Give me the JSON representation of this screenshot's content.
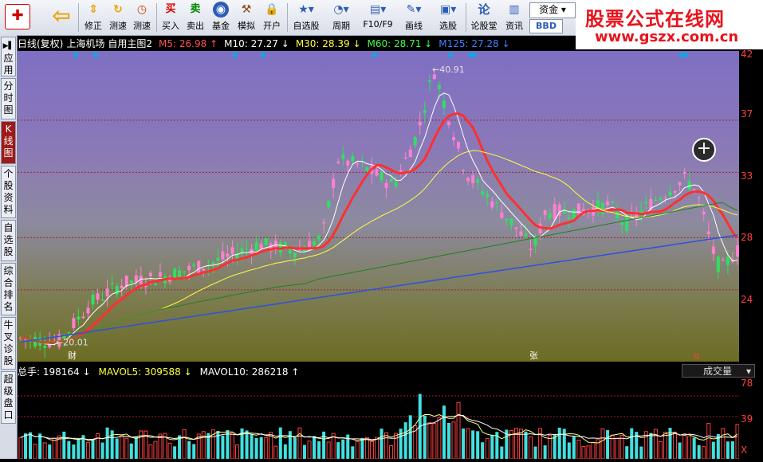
{
  "toolbar": {
    "items": [
      {
        "label": "",
        "icon": "app-logo-icon"
      },
      {
        "label": "",
        "icon": "back-arrow-icon"
      },
      {
        "label": "修正",
        "icon": "up-down-arrows-icon"
      },
      {
        "label": "测速",
        "icon": "timer-icon"
      },
      {
        "label": "买入",
        "icon": "buy-icon",
        "glyph": "买"
      },
      {
        "label": "卖出",
        "icon": "sell-icon",
        "glyph": "卖"
      },
      {
        "label": "基金",
        "icon": "fund-icon"
      },
      {
        "label": "模拟",
        "icon": "hammer-icon"
      },
      {
        "label": "开户",
        "icon": "lock-icon"
      },
      {
        "label": "自选股",
        "icon": "star-folder-icon"
      },
      {
        "label": "周期",
        "icon": "clock-icon"
      },
      {
        "label": "F10/F9",
        "icon": "f10-icon"
      },
      {
        "label": "画线",
        "icon": "pencil-icon"
      },
      {
        "label": "选股",
        "icon": "monitor-icon"
      },
      {
        "label": "论股堂",
        "icon": "forum-icon",
        "glyph": "论"
      },
      {
        "label": "资讯",
        "icon": "news-icon"
      }
    ],
    "fund_button": "资金",
    "bbd_button": "BBD"
  },
  "watermark": {
    "title": "股票公式在线网",
    "url": "www.gszx.com.cn"
  },
  "side_tabs": [
    "应用",
    "分时图",
    "K线图",
    "个股资料",
    "自选股",
    "综合排名",
    "牛叉诊股",
    "超级盘口"
  ],
  "info": {
    "mode": "日线(复权)",
    "stock": "上海机场",
    "formula": "自用主图2",
    "ma": [
      {
        "text": "M5: 26.98",
        "color": "#ff5050",
        "arrow": "up"
      },
      {
        "text": "M10: 27.27",
        "color": "#ffffff",
        "arrow": "down"
      },
      {
        "text": "M30: 28.39",
        "color": "#ffff40",
        "arrow": "down"
      },
      {
        "text": "M60: 28.71",
        "color": "#40ff40",
        "arrow": "down"
      },
      {
        "text": "M125: 27.28",
        "color": "#4080ff",
        "arrow": "down"
      }
    ]
  },
  "annotations": {
    "high": "40.91",
    "low": "20.01",
    "marker1": "财",
    "marker2": "张",
    "marker3": "q"
  },
  "right_scale": [
    "42",
    "37",
    "33",
    "28",
    "24"
  ],
  "volume_scale": [
    "78",
    "39",
    "X"
  ],
  "volume_info": [
    {
      "text": "总手: 198164",
      "color": "#ffffff",
      "arrow": "down"
    },
    {
      "text": "MAVOL5: 309588",
      "color": "#ffff40",
      "arrow": "down"
    },
    {
      "text": "MAVOL10: 286218",
      "color": "#ffffff",
      "arrow": "up"
    }
  ],
  "volume_selector": "成交量",
  "colors": {
    "up": "#ff5050",
    "down": "#30e0e0",
    "ma5": "#ffffff",
    "ma30": "#ffff40",
    "ma60": "#40b040",
    "ma125": "#3050e0"
  }
}
